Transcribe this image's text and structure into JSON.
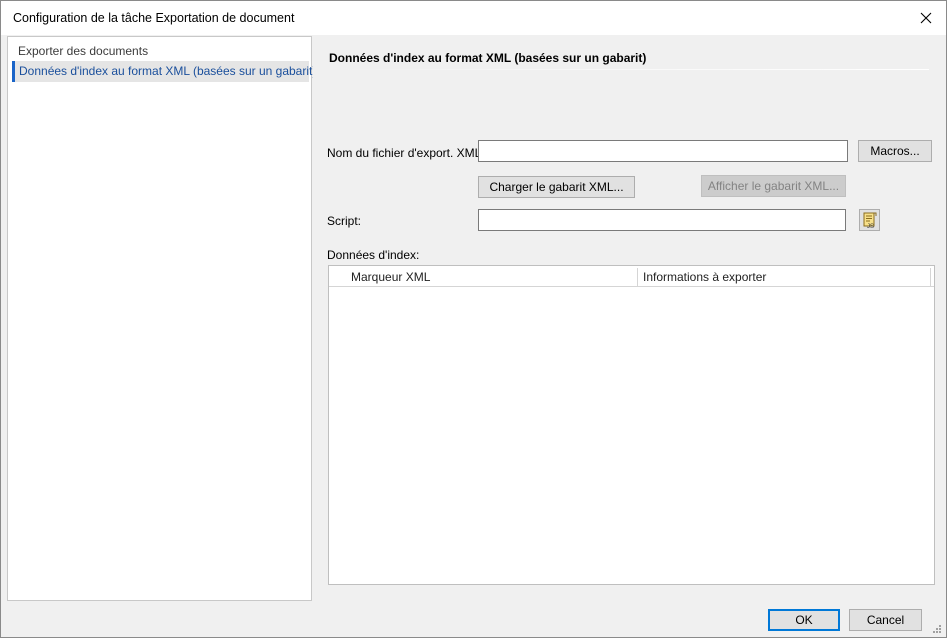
{
  "window": {
    "title": "Configuration de la tâche Exportation de document"
  },
  "sidebar": {
    "items": [
      {
        "label": "Exporter des documents"
      },
      {
        "label": "Données d'index au format XML (basées sur un gabarit)"
      }
    ]
  },
  "main": {
    "section_title": "Données d'index au format XML (basées sur un gabarit)",
    "filename_label": "Nom du fichier d'export. XML:",
    "filename_value": "",
    "macros_label": "Macros...",
    "load_template_label": "Charger le gabarit XML...",
    "show_template_label": "Afficher le gabarit XML...",
    "script_label": "Script:",
    "script_value": "",
    "index_data_label": "Données d'index:",
    "table": {
      "columns": [
        "Marqueur XML",
        "Informations à exporter"
      ],
      "rows": []
    }
  },
  "footer": {
    "ok_label": "OK",
    "cancel_label": "Cancel"
  },
  "icons": {
    "close": "close-icon",
    "script_editor": "js-script-icon",
    "resize": "resize-grip-icon"
  },
  "colors": {
    "accent": "#0078d7",
    "selection_text": "#1a4f9c",
    "disabled_text": "#838383"
  }
}
